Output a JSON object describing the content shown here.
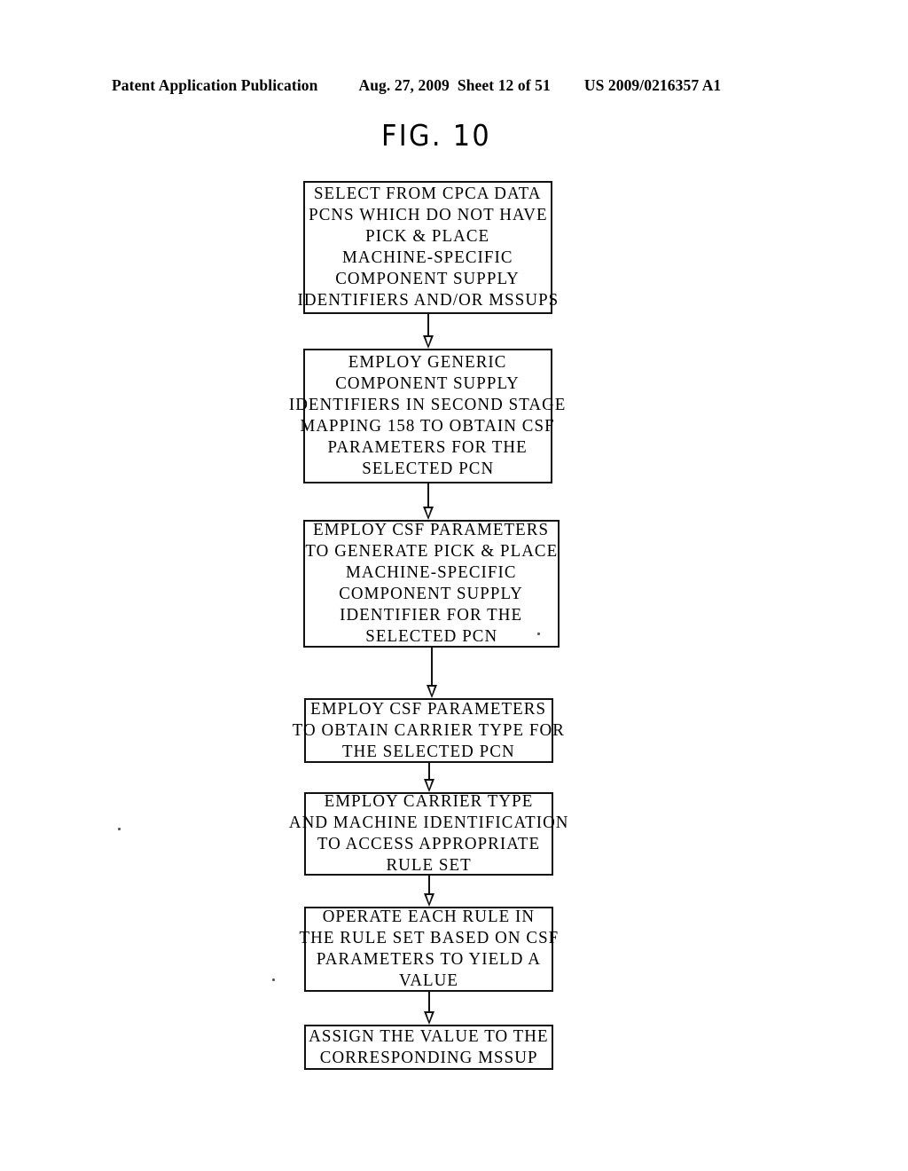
{
  "header": {
    "publication": "Patent Application Publication",
    "date": "Aug. 27, 2009",
    "sheet": "Sheet 12 of 51",
    "patent_number": "US 2009/0216357 A1"
  },
  "figure": {
    "title": "FIG. 10"
  },
  "flowchart": {
    "type": "flowchart",
    "orientation": "vertical",
    "connector": "arrow-down",
    "boxes": [
      {
        "id": "box-1",
        "name": "select-pcns-without-mssup",
        "lines": [
          "SELECT FROM CPCA DATA",
          "PCNS WHICH DO NOT HAVE",
          "PICK & PLACE",
          "MACHINE-SPECIFIC",
          "COMPONENT SUPPLY",
          "IDENTIFIERS AND/OR MSSUPS"
        ]
      },
      {
        "id": "box-2",
        "name": "employ-generic-identifiers-second-stage",
        "lines": [
          "EMPLOY GENERIC",
          "COMPONENT SUPPLY",
          "IDENTIFIERS IN SECOND STAGE",
          "MAPPING 158 TO OBTAIN CSF",
          "PARAMETERS FOR THE",
          "SELECTED PCN"
        ]
      },
      {
        "id": "box-3",
        "name": "generate-machine-specific-identifier",
        "lines": [
          "EMPLOY CSF PARAMETERS",
          "TO GENERATE PICK & PLACE",
          "MACHINE-SPECIFIC",
          "COMPONENT SUPPLY",
          "IDENTIFIER FOR THE",
          "SELECTED PCN"
        ]
      },
      {
        "id": "box-4",
        "name": "obtain-carrier-type",
        "lines": [
          "EMPLOY CSF PARAMETERS",
          "TO OBTAIN CARRIER TYPE FOR",
          "THE SELECTED PCN"
        ]
      },
      {
        "id": "box-5",
        "name": "access-appropriate-rule-set",
        "lines": [
          "EMPLOY CARRIER TYPE",
          "AND MACHINE IDENTIFICATION",
          "TO ACCESS APPROPRIATE",
          "RULE SET"
        ]
      },
      {
        "id": "box-6",
        "name": "operate-rules-to-yield-value",
        "lines": [
          "OPERATE EACH RULE IN",
          "THE RULE SET BASED ON CSF",
          "PARAMETERS TO YIELD A",
          "VALUE"
        ]
      },
      {
        "id": "box-7",
        "name": "assign-value-to-mssup",
        "lines": [
          "ASSIGN THE VALUE TO THE",
          "CORRESPONDING MSSUP"
        ]
      }
    ]
  }
}
